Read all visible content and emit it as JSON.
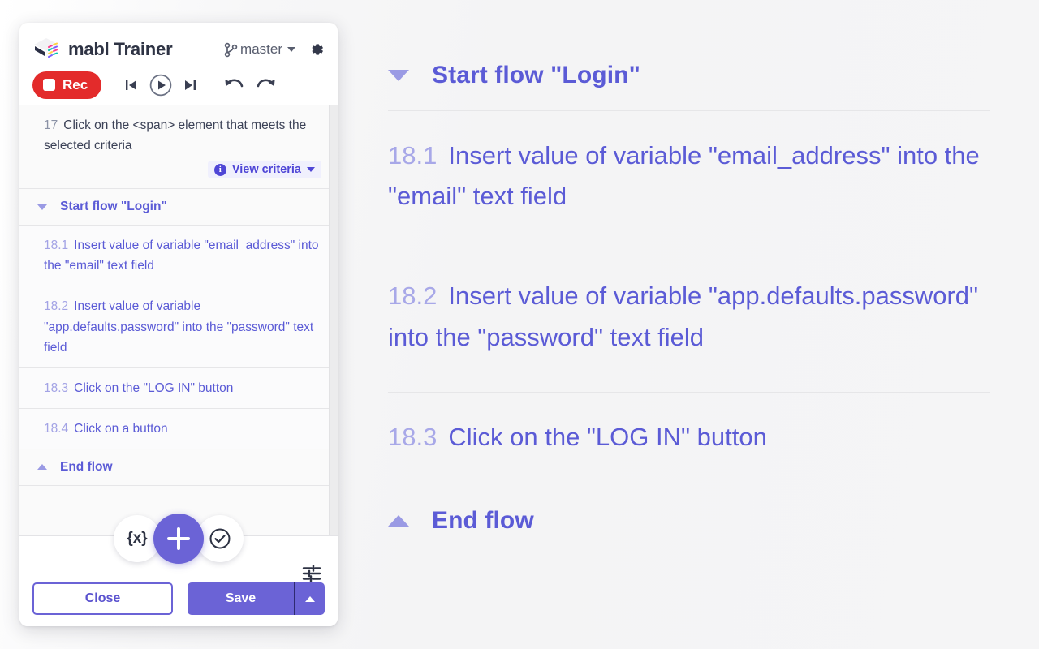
{
  "app": {
    "brand": "mabl Trainer",
    "branch": "master",
    "logo_icon": "mabl-cube-logo"
  },
  "toolbar": {
    "record_label": "Rec",
    "icons": [
      {
        "name": "skip-to-start-icon",
        "glyph": "|<"
      },
      {
        "name": "play-icon",
        "glyph": "play"
      },
      {
        "name": "skip-to-end-icon",
        "glyph": ">|"
      },
      {
        "name": "undo-icon",
        "glyph": "undo"
      },
      {
        "name": "redo-icon",
        "glyph": "redo"
      }
    ],
    "settings_icon": "gear-icon",
    "branch_icon": "git-branch-icon"
  },
  "steps": [
    {
      "type": "step",
      "number": "17",
      "text": "Click on the <span> element that meets the selected criteria",
      "criteria_label": "View criteria",
      "has_criteria": true
    },
    {
      "type": "flow-start",
      "label": "Start flow \"Login\""
    },
    {
      "type": "step",
      "number": "18.1",
      "text": "Insert value of variable \"email_address\" into the \"email\" text field",
      "has_criteria": false
    },
    {
      "type": "step",
      "number": "18.2",
      "text": "Insert value of variable \"app.defaults.password\" into the \"password\" text field",
      "has_criteria": false
    },
    {
      "type": "step",
      "number": "18.3",
      "text": "Click on the \"LOG IN\" button",
      "has_criteria": false
    },
    {
      "type": "step",
      "number": "18.4",
      "text": "Click on a button",
      "has_criteria": false
    },
    {
      "type": "flow-end",
      "label": "End flow"
    }
  ],
  "step_list": {
    "s0_num": "17",
    "s0_text": "Click on the <span> element that meets the selected criteria",
    "s0_criteria": "View criteria",
    "flow_start": "Start flow \"Login\"",
    "s1_num": "18.1",
    "s1_text": "Insert value of variable \"email_address\" into the \"email\" text field",
    "s2_num": "18.2",
    "s2_text": "Insert value of variable \"app.defaults.password\" into the \"password\" text field",
    "s3_num": "18.3",
    "s3_text": "Click on the \"LOG IN\" button",
    "s4_num": "18.4",
    "s4_text": "Click on a button",
    "flow_end": "End flow"
  },
  "magnified": {
    "flow_start": "Start flow \"Login\"",
    "s1_num": "18.1",
    "s1_text": "Insert value of variable \"email_address\" into the \"email\" text field",
    "s2_num": "18.2",
    "s2_text": "Insert value of variable \"app.defaults.password\" into the \"password\" text field",
    "s3_num": "18.3",
    "s3_text": "Click on the \"LOG IN\" button",
    "flow_end": "End flow"
  },
  "actions": {
    "variable_label": "{x}",
    "add_icon": "plus-icon",
    "assert_icon": "check-circle-icon",
    "tune_icon": "sliders-icon",
    "close_label": "Close",
    "save_label": "Save",
    "save_dropdown_icon": "chevron-up-icon"
  },
  "colors": {
    "accent_purple": "#6b63d6",
    "step_purple": "#5b5bd6",
    "step_number_purple": "#a3a3e5",
    "record_red": "#e32b2b",
    "text_dark": "#3c4257",
    "panel_bg": "#fafafa"
  }
}
